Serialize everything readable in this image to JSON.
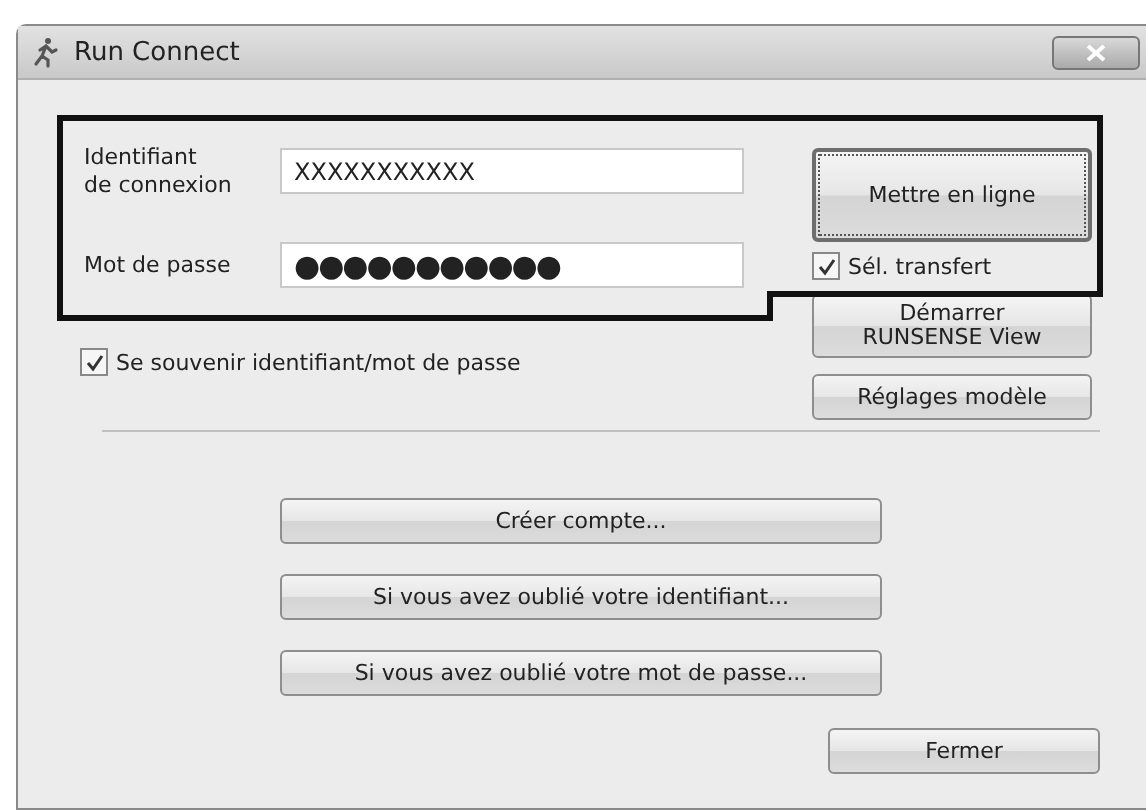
{
  "window": {
    "title": "Run Connect"
  },
  "login": {
    "id_label": "Identifiant\nde connexion",
    "id_value": "XXXXXXXXXXX",
    "password_label": "Mot de passe",
    "password_value": "●●●●●●●●●●●"
  },
  "upload_button": "Mettre en ligne",
  "transfer_checkbox": {
    "label": "Sél. transfert",
    "checked": true
  },
  "remember_checkbox": {
    "label": "Se souvenir identifiant/mot de passe",
    "checked": true
  },
  "side_buttons": [
    "Démarrer\nRUNSENSE View",
    "Réglages modèle"
  ],
  "account_buttons": [
    "Créer compte...",
    "Si vous avez oublié votre identifiant...",
    "Si vous avez oublié votre mot de passe..."
  ],
  "close_button": "Fermer"
}
